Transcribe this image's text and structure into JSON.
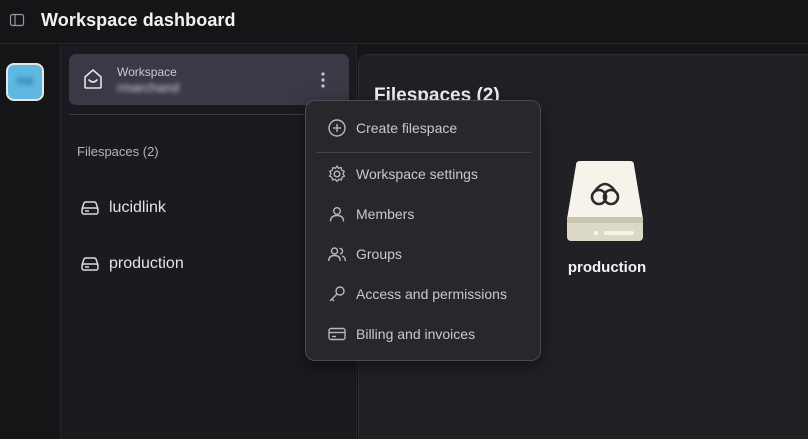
{
  "header": {
    "title": "Workspace dashboard",
    "panel_toggle_icon": "sidebar-toggle-icon"
  },
  "rail": {
    "avatar_initials": "RM"
  },
  "sidebar": {
    "workspace_card": {
      "label": "Workspace",
      "user": "rmarchand",
      "icon": "home-icon",
      "menu_icon": "kebab-icon"
    },
    "filespaces_heading": "Filespaces (2)",
    "filespaces": [
      {
        "label": "lucidlink",
        "icon": "drive-icon"
      },
      {
        "label": "production",
        "icon": "drive-icon"
      }
    ]
  },
  "main": {
    "heading": "Filespaces (2)",
    "tiles": [
      {
        "label": "production",
        "icon": "lucidlink-drive-icon"
      }
    ]
  },
  "menu": {
    "items": [
      {
        "label": "Create filespace",
        "icon": "plus-circle-icon"
      },
      {
        "label": "Workspace settings",
        "icon": "gear-icon"
      },
      {
        "label": "Members",
        "icon": "user-icon"
      },
      {
        "label": "Groups",
        "icon": "users-icon"
      },
      {
        "label": "Access and permissions",
        "icon": "key-icon"
      },
      {
        "label": "Billing and invoices",
        "icon": "credit-card-icon"
      }
    ]
  },
  "colors": {
    "background": "#151518",
    "panel": "#1b1b1f",
    "workspace_card": "#3a3946",
    "menu_bg": "#27272c",
    "avatar": "#5eb8df"
  }
}
